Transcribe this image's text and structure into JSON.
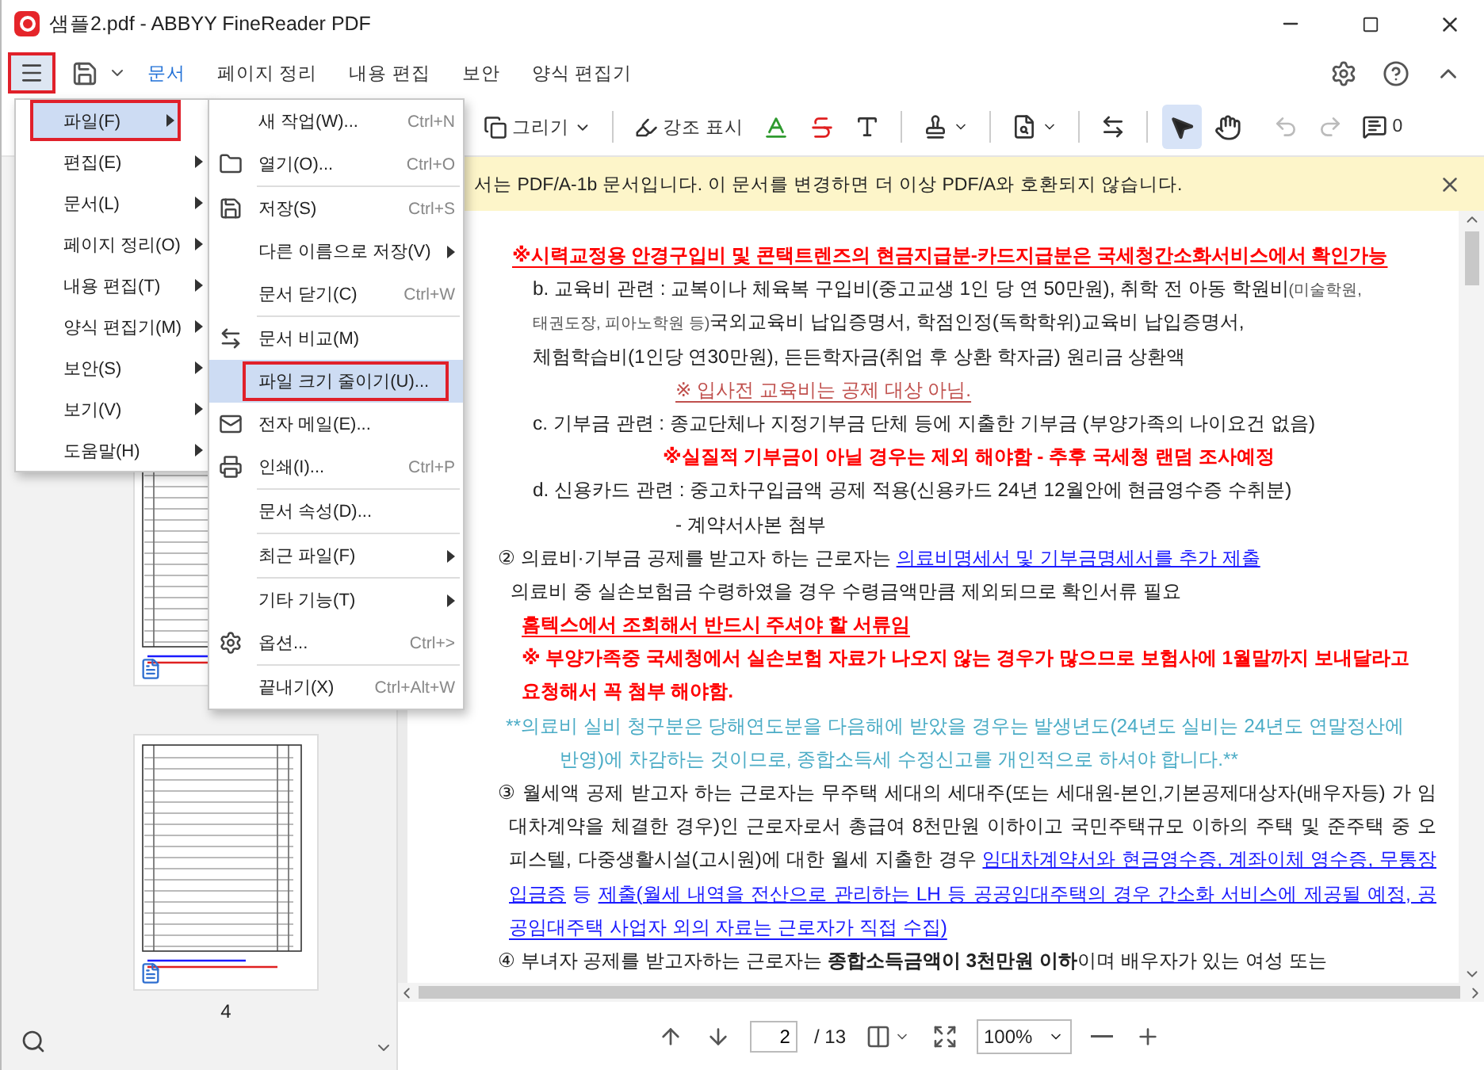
{
  "window": {
    "title": "샘플2.pdf - ABBYY FineReader PDF"
  },
  "menu_button": {
    "annotated": true
  },
  "ribbon_tabs": [
    {
      "label": "문서",
      "selected": true
    },
    {
      "label": "페이지 정리",
      "selected": false
    },
    {
      "label": "내용 편집",
      "selected": false
    },
    {
      "label": "보안",
      "selected": false
    },
    {
      "label": "양식 편집기",
      "selected": false
    }
  ],
  "toolbar": {
    "draw_label": "그리기",
    "highlight_label": "강조 표시",
    "comment_count": "0",
    "tools": [
      {
        "selected": true
      },
      {
        "selected": false
      }
    ]
  },
  "notification": {
    "text": "서는 PDF/A-1b 문서입니다. 이 문서를 변경하면 더 이상 PDF/A와 호환되지 않습니다."
  },
  "main_menu": [
    {
      "label": "파일(F)",
      "selected": true,
      "annotated": true
    },
    {
      "label": "편집(E)",
      "selected": false,
      "annotated": false
    },
    {
      "label": "문서(L)",
      "selected": false,
      "annotated": false
    },
    {
      "label": "페이지 정리(O)",
      "selected": false,
      "annotated": false
    },
    {
      "label": "내용 편집(T)",
      "selected": false,
      "annotated": false
    },
    {
      "label": "양식 편집기(M)",
      "selected": false,
      "annotated": false
    },
    {
      "label": "보안(S)",
      "selected": false,
      "annotated": false
    },
    {
      "label": "보기(V)",
      "selected": false,
      "annotated": false
    },
    {
      "label": "도움말(H)",
      "selected": false,
      "annotated": false
    }
  ],
  "file_menu": [
    {
      "kind": "item",
      "label": "새 작업(W)...",
      "shortcut": "Ctrl+N",
      "has_submenu": false,
      "selected": false,
      "annotated": false
    },
    {
      "kind": "item",
      "label": "열기(O)...",
      "shortcut": "Ctrl+O",
      "has_submenu": false,
      "selected": false,
      "annotated": false
    },
    {
      "kind": "separator"
    },
    {
      "kind": "item",
      "label": "저장(S)",
      "shortcut": "Ctrl+S",
      "has_submenu": false,
      "selected": false,
      "annotated": false
    },
    {
      "kind": "item",
      "label": "다른 이름으로 저장(V)",
      "has_submenu": true,
      "selected": false,
      "annotated": false
    },
    {
      "kind": "item",
      "label": "문서 닫기(C)",
      "shortcut": "Ctrl+W",
      "has_submenu": false,
      "selected": false,
      "annotated": false
    },
    {
      "kind": "separator"
    },
    {
      "kind": "item",
      "label": "문서 비교(M)",
      "has_submenu": false,
      "selected": false,
      "annotated": false
    },
    {
      "kind": "item",
      "label": "파일 크기 줄이기(U)...",
      "has_submenu": false,
      "selected": true,
      "annotated": true
    },
    {
      "kind": "item",
      "label": "전자 메일(E)...",
      "has_submenu": false,
      "selected": false,
      "annotated": false
    },
    {
      "kind": "item",
      "label": "인쇄(I)...",
      "shortcut": "Ctrl+P",
      "has_submenu": false,
      "selected": false,
      "annotated": false
    },
    {
      "kind": "separator"
    },
    {
      "kind": "item",
      "label": "문서 속성(D)...",
      "has_submenu": false,
      "selected": false,
      "annotated": false
    },
    {
      "kind": "separator"
    },
    {
      "kind": "item",
      "label": "최근 파일(F)",
      "has_submenu": true,
      "selected": false,
      "annotated": false
    },
    {
      "kind": "separator"
    },
    {
      "kind": "item",
      "label": "기타 기능(T)",
      "has_submenu": true,
      "selected": false,
      "annotated": false
    },
    {
      "kind": "item",
      "label": "옵션...",
      "shortcut": "Ctrl+>",
      "has_submenu": false,
      "selected": false,
      "annotated": false
    },
    {
      "kind": "separator"
    },
    {
      "kind": "item",
      "label": "끝내기(X)",
      "shortcut": "Ctrl+Alt+W",
      "has_submenu": false,
      "selected": false,
      "annotated": false
    }
  ],
  "sidebar": {
    "page_label": "4"
  },
  "document": {
    "lines": [
      {
        "kind": "alert",
        "color": "#ff0000",
        "underlined": true,
        "segments": [
          {
            "kind": "text",
            "text": "※시력교정용 안경구입비 및 콘택트렌즈의 현금지급분-카드지급분은 국세청간소화서비스에서 확인가능"
          }
        ]
      },
      {
        "kind": "sub",
        "color": "#222222",
        "underlined": false,
        "segments": [
          {
            "kind": "text",
            "text": "b. 교육비 관련 : 교복이나 체육복 구입비(중고교생 1인 당 연 50만원), 취학 전 아동 학원비"
          },
          {
            "kind": "small",
            "text": "(미술학원,"
          }
        ]
      },
      {
        "kind": "sub",
        "color": "#222222",
        "underlined": false,
        "segments": [
          {
            "kind": "small",
            "text": "태권도장, 피아노학원 등)"
          },
          {
            "kind": "text",
            "text": "국외교육비 납입증명서, 학점인정(독학학위)교육비 납입증명서,"
          }
        ]
      },
      {
        "kind": "sub",
        "color": "#222222",
        "underlined": false,
        "segments": [
          {
            "kind": "text",
            "text": "체험학습비(1인당 연30만원), 든든학자금(취업 후 상환 학자금) 원리금 상환액"
          }
        ]
      },
      {
        "kind": "aside",
        "color": "#c0504d",
        "underlined": true,
        "segments": [
          {
            "kind": "text",
            "text": "※ 입사전 교육비는 공제 대상 아님."
          }
        ]
      },
      {
        "kind": "sub",
        "color": "#222222",
        "underlined": false,
        "segments": [
          {
            "kind": "text",
            "text": "c. 기부금 관련 : 종교단체나 지정기부금 단체 등에 지출한 기부금 (부양가족의 나이요건 없음)"
          }
        ]
      },
      {
        "kind": "aside-bold",
        "color": "#ff0000",
        "underlined": false,
        "segments": [
          {
            "kind": "text",
            "text": "※실질적 기부금이 아닐 경우는 제외 해야함 -   추후 국세청 랜덤 조사예정"
          }
        ]
      },
      {
        "kind": "sub",
        "color": "#222222",
        "underlined": false,
        "segments": [
          {
            "kind": "text",
            "text": "d. 신용카드 관련 : 중고차구입금액 공제 적용(신용카드 24년 12월안에 현금영수증 수취분)"
          }
        ]
      },
      {
        "kind": "aside",
        "color": "#222222",
        "underlined": false,
        "segments": [
          {
            "kind": "text",
            "text": "- 계약서사본 첨부"
          }
        ]
      },
      {
        "kind": "lead",
        "color": "#222222",
        "underlined": false,
        "segments": [
          {
            "kind": "text",
            "text": "② 의료비·기부금 공제를 받고자 하는 근로자는 "
          },
          {
            "kind": "link",
            "text": "의료비명세서 및 기부금명세서를 추가 제출"
          }
        ]
      },
      {
        "kind": "body",
        "color": "#222222",
        "underlined": false,
        "segments": [
          {
            "kind": "text",
            "text": "의료비 중 실손보험금 수령하였을 경우 수령금액만큼 제외되므로 확인서류 필요"
          }
        ]
      },
      {
        "kind": "remark",
        "color": "#ff0000",
        "underlined": true,
        "segments": [
          {
            "kind": "text",
            "text": "홈텍스에서 조회해서 반드시 주셔야 할 서류임"
          }
        ]
      },
      {
        "kind": "remark",
        "color": "#ff0000",
        "underlined": false,
        "segments": [
          {
            "kind": "text",
            "text": "※ 부양가족중 국세청에서 실손보험 자료가 나오지 않는 경우가 많으므로 보험사에 1월말까지  보내달라고"
          }
        ]
      },
      {
        "kind": "remark",
        "color": "#ff0000",
        "underlined": false,
        "segments": [
          {
            "kind": "text",
            "text": "요청해서 꼭 첨부 해야함."
          }
        ]
      },
      {
        "kind": "note",
        "color": "#4bacc6",
        "underlined": false,
        "segments": [
          {
            "kind": "text",
            "text": "**의료비 실비 청구분은 당해연도분을 다음해에 받았을 경우는 발생년도(24년도 실비는 24년도 연말정산에"
          }
        ]
      },
      {
        "kind": "note-cont",
        "color": "#4bacc6",
        "underlined": false,
        "segments": [
          {
            "kind": "text",
            "text": "반영)에 차감하는 것이므로, 종합소득세 수정신고를 개인적으로 하셔야 합니다.**"
          }
        ]
      },
      {
        "kind": "wrap-first",
        "color": "#222222",
        "underlined": false,
        "segments": [
          {
            "kind": "text",
            "text": "③ 월세액 공제 받고자 하는 근로자는 무주택 세대의 세대주(또는 세대원-본인,기본공제대상자(배우자등) 가 임"
          }
        ]
      },
      {
        "kind": "wrap",
        "color": "#222222",
        "underlined": false,
        "segments": [
          {
            "kind": "text",
            "text": "대차계약을 체결한 경우)인 근로자로서 총급여 8천만원 이하이고 국민주택규모 이하의 주택 및 준주택 중 오"
          }
        ]
      },
      {
        "kind": "wrap",
        "color": "#222222",
        "underlined": false,
        "segments": [
          {
            "kind": "text",
            "text": "피스텔, 다중생활시설(고시원)에 대한 월세 지출한 경우 "
          },
          {
            "kind": "link",
            "text": "임대차계약서와 현금영수증, 계좌이체 영수증, 무통장"
          }
        ]
      },
      {
        "kind": "wrap",
        "color": "#1a1aff",
        "underlined": false,
        "segments": [
          {
            "kind": "link",
            "text": "입금증"
          },
          {
            "kind": "text",
            "text": " 등 "
          },
          {
            "kind": "link",
            "text": "제출(월세 내역을 전산으로 관리하는 LH 등 공공임대주택의 경우 간소화 서비스에 제공될 예정, 공"
          }
        ]
      },
      {
        "kind": "wrap-end",
        "color": "#1a1aff",
        "underlined": true,
        "segments": [
          {
            "kind": "text",
            "text": "공임대주택 사업자 외의 자료는 근로자가 직접 수집)"
          }
        ]
      },
      {
        "kind": "lead",
        "color": "#222222",
        "underlined": false,
        "segments": [
          {
            "kind": "text",
            "text": "④ 부녀자 공제를 받고자하는 근로자는 "
          },
          {
            "kind": "bold",
            "text": "종합소득금액이 3천만원 이하"
          },
          {
            "kind": "text",
            "text": "이며 배우자가 있는 여성 또는"
          }
        ]
      }
    ]
  },
  "navigation": {
    "page": "2",
    "total": "/ 13",
    "zoom": "100%"
  }
}
